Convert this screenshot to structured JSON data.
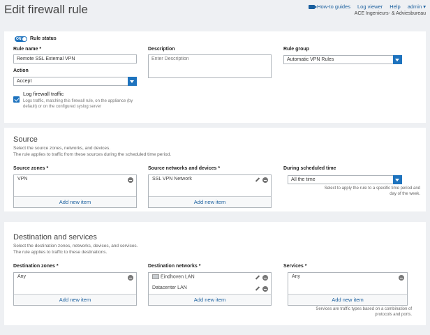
{
  "page_title": "Edit firewall rule",
  "toplinks": {
    "howto": "How-to guides",
    "logviewer": "Log viewer",
    "help": "Help",
    "admin": "admin"
  },
  "org": "ACE Ingenieurs- & Adviesbureau",
  "rule": {
    "status_on": "ON",
    "status_label": "Rule status",
    "name_label": "Rule name *",
    "name_value": "Remote SSL External VPN",
    "description_label": "Description",
    "description_placeholder": "Enter Description",
    "group_label": "Rule group",
    "group_value": "Automatic VPN Rules",
    "action_label": "Action",
    "action_value": "Accept",
    "log_label": "Log firewall traffic",
    "log_hint_1": "Logs traffic, matching this firewall rule, on the appliance (by",
    "log_hint_2": "default) or on the configured syslog server"
  },
  "source": {
    "heading": "Source",
    "desc1": "Select the source zones, networks, and devices.",
    "desc2": "The rule applies to traffic from these sources during the scheduled time period.",
    "zones_label": "Source zones *",
    "zones_items": [
      "VPN"
    ],
    "networks_label": "Source networks and devices *",
    "networks_items": [
      "SSL VPN Network"
    ],
    "schedule_label": "During scheduled time",
    "schedule_value": "All the time",
    "schedule_hint_1": "Select to apply the rule to a specific time period and",
    "schedule_hint_2": "day of the week.",
    "add_new": "Add new item"
  },
  "destination": {
    "heading": "Destination and services",
    "desc1": "Select the destination zones, networks, devices, and services.",
    "desc2": "The rule applies to traffic to these destinations.",
    "zones_label": "Destination zones *",
    "zones_items": [
      "Any"
    ],
    "networks_label": "Destination networks *",
    "networks_items": [
      "Eindhoven LAN",
      "Datacenter LAN"
    ],
    "services_label": "Services *",
    "services_items": [
      "Any"
    ],
    "services_hint_1": "Services are traffic types based on a combination of",
    "services_hint_2": "protocols and ports.",
    "add_new": "Add new item"
  }
}
